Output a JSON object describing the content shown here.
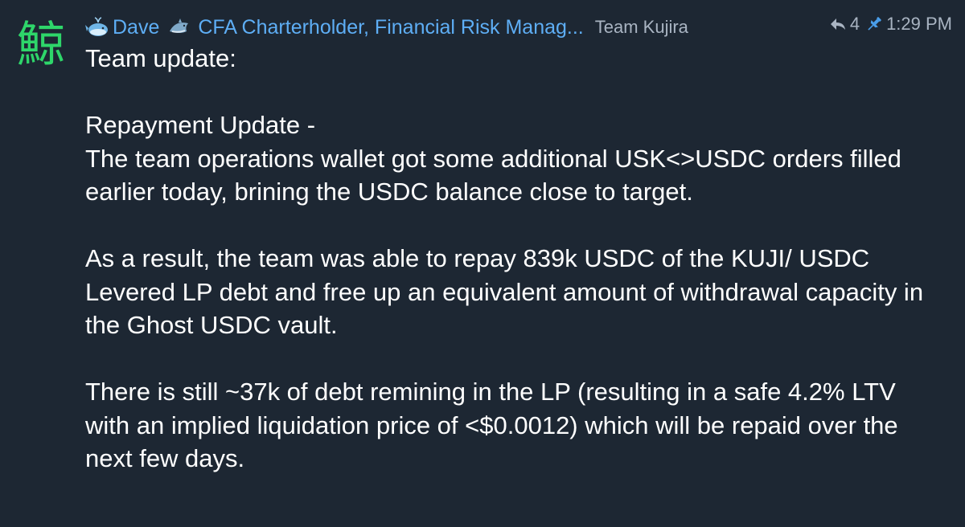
{
  "message": {
    "author": "Dave",
    "author_title": "CFA Charterholder, Financial Risk Manag...",
    "team_tag": "Team Kujira",
    "reply_count": "4",
    "time": "1:29 PM",
    "avatar_glyph": "鯨",
    "icons": {
      "author_emoji": "whale-icon",
      "title_emoji": "dolphin-icon",
      "reply": "reply-arrow-icon",
      "pin": "pin-icon"
    },
    "colors": {
      "background": "#1d2733",
      "author_name": "#5eaef5",
      "meta_text": "#a9b4c2",
      "body_text": "#ffffff",
      "avatar_glyph": "#2ed66a"
    },
    "paragraphs": [
      "Team update:",
      "",
      "Repayment Update -",
      "The team operations wallet got some additional USK<>USDC orders filled earlier today, brining the USDC balance close to target.",
      "",
      "As a result, the team was able to repay 839k USDC of the KUJI/ USDC Levered LP debt and free up an equivalent amount of withdrawal capacity in the Ghost USDC vault.",
      "",
      "There is still ~37k of debt remining in the LP (resulting in a safe 4.2% LTV with an implied liquidation price of <$0.0012) which will be repaid over the next few days."
    ]
  }
}
